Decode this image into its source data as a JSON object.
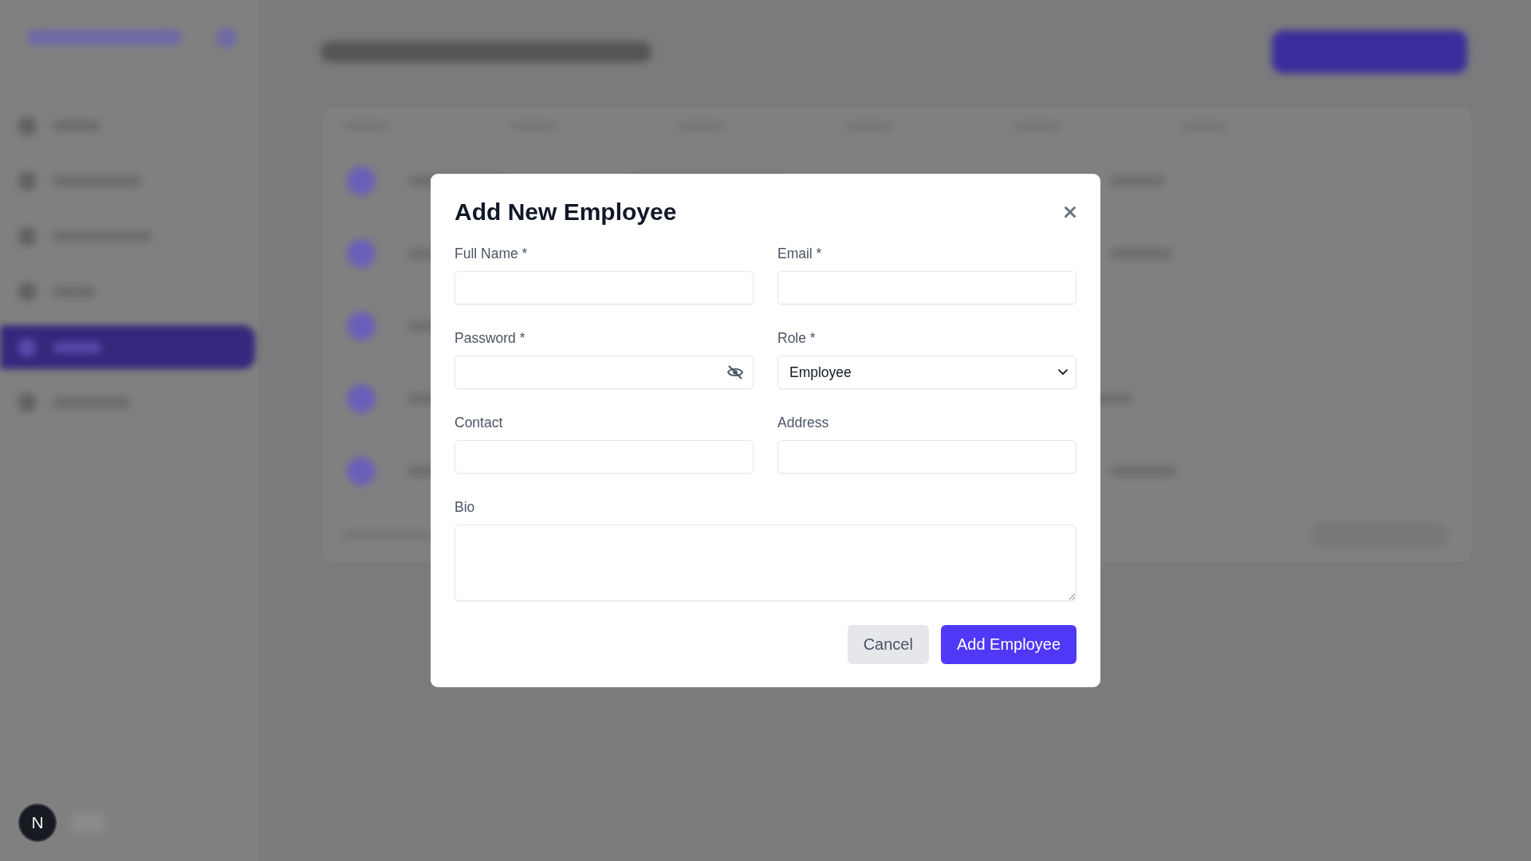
{
  "background_sidebar": {
    "nav_items": [
      {
        "selected": false
      },
      {
        "selected": false
      },
      {
        "selected": false
      },
      {
        "selected": false
      },
      {
        "selected": true
      },
      {
        "selected": false
      }
    ]
  },
  "dialog": {
    "title": "Add New Employee",
    "fields": [
      {
        "kind": "text",
        "label": "Full Name *"
      },
      {
        "kind": "text",
        "label": "Email *"
      },
      {
        "kind": "password",
        "label": "Password *",
        "revealed": false
      },
      {
        "kind": "select",
        "label": "Role *",
        "value": "Employee"
      },
      {
        "kind": "text",
        "label": "Contact"
      },
      {
        "kind": "text",
        "label": "Address"
      },
      {
        "kind": "textarea",
        "label": "Bio"
      }
    ],
    "buttons": [
      {
        "kind": "secondary",
        "label": "Cancel"
      },
      {
        "kind": "primary",
        "label": "Add Employee"
      }
    ]
  },
  "dev_indicator": {
    "label": "N"
  }
}
